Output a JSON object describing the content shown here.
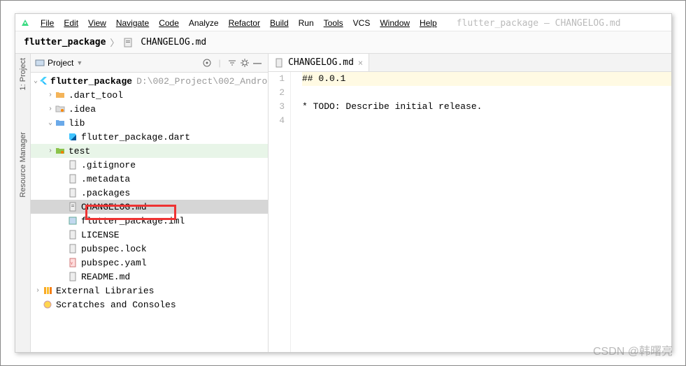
{
  "window_context": "flutter_package – CHANGELOG.md",
  "menu": [
    "File",
    "Edit",
    "View",
    "Navigate",
    "Code",
    "Analyze",
    "Refactor",
    "Build",
    "Run",
    "Tools",
    "VCS",
    "Window",
    "Help"
  ],
  "breadcrumbs": {
    "root": "flutter_package",
    "file": "CHANGELOG.md"
  },
  "left_strip": {
    "item1": "1: Project",
    "item2": "Resource Manager"
  },
  "project_panel": {
    "title": "Project",
    "toolbar_icons": [
      "target",
      "filter",
      "gear",
      "minimize"
    ],
    "tree": {
      "root_name": "flutter_package",
      "root_path": "D:\\002_Project\\002_Andro",
      "children": [
        {
          "name": ".dart_tool",
          "type": "folder-orange",
          "arrow": ">"
        },
        {
          "name": ".idea",
          "type": "folder-dot",
          "arrow": ">"
        },
        {
          "name": "lib",
          "type": "folder-blue",
          "arrow": "v",
          "children": [
            {
              "name": "flutter_package.dart",
              "type": "dart"
            }
          ]
        },
        {
          "name": "test",
          "type": "folder-test",
          "arrow": ">",
          "highlight": "green"
        },
        {
          "name": ".gitignore",
          "type": "file"
        },
        {
          "name": ".metadata",
          "type": "file"
        },
        {
          "name": ".packages",
          "type": "file"
        },
        {
          "name": "CHANGELOG.md",
          "type": "md",
          "selected": true,
          "red_box": true
        },
        {
          "name": "flutter_package.iml",
          "type": "iml"
        },
        {
          "name": "LICENSE",
          "type": "file"
        },
        {
          "name": "pubspec.lock",
          "type": "file"
        },
        {
          "name": "pubspec.yaml",
          "type": "yaml"
        },
        {
          "name": "README.md",
          "type": "md"
        }
      ],
      "external": "External Libraries",
      "scratches": "Scratches and Consoles"
    }
  },
  "editor": {
    "tab_label": "CHANGELOG.md",
    "lines": [
      "## 0.0.1",
      "",
      "* TODO: Describe initial release.",
      ""
    ],
    "line_numbers": [
      "1",
      "2",
      "3",
      "4"
    ]
  },
  "watermark": "CSDN @韩曙亮"
}
